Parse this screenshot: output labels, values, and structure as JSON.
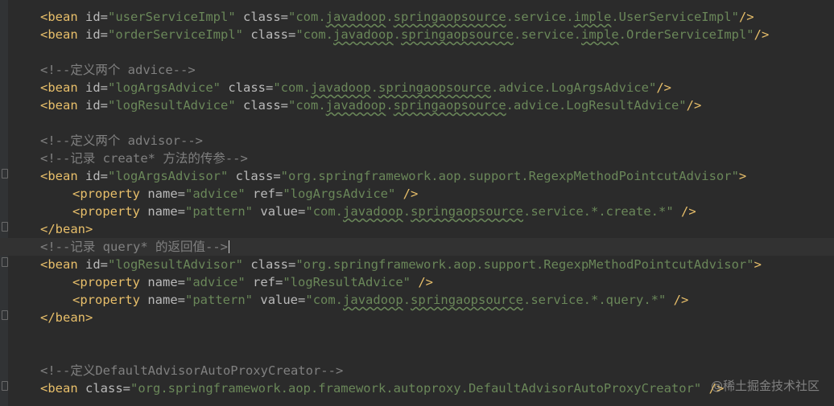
{
  "lines": [
    {
      "open": "<bean",
      "id": "\"userServiceImpl\"",
      "cls_pre": "\"com.",
      "cls_w1": "javadoop",
      "cls_mid": ".",
      "cls_w2": "springaopsource",
      "cls_mid2": ".service.",
      "cls_w3": "imple",
      "cls_post": ".UserServiceImpl\"",
      "close": "/>"
    },
    {
      "open": "<bean",
      "id": "\"orderServiceImpl\"",
      "cls_pre": "\"com.",
      "cls_w1": "javadoop",
      "cls_mid": ".",
      "cls_w2": "springaopsource",
      "cls_mid2": ".service.",
      "cls_w3": "imple",
      "cls_post": ".OrderServiceImpl\"",
      "close": "/>"
    }
  ],
  "comment_advice": "<!--定义两个 advice-->",
  "advice_beans": [
    {
      "open": "<bean",
      "id": "\"logArgsAdvice\"",
      "cls_pre": "\"com.",
      "cls_w1": "javadoop",
      "cls_mid": ".",
      "cls_w2": "springaopsource",
      "cls_post": ".advice.LogArgsAdvice\"",
      "close": "/>"
    },
    {
      "open": "<bean",
      "id": "\"logResultAdvice\"",
      "cls_pre": "\"com.",
      "cls_w1": "javadoop",
      "cls_mid": ".",
      "cls_w2": "springaopsource",
      "cls_post": ".advice.LogResultAdvice\"",
      "close": "/>"
    }
  ],
  "comment_advisor": "<!--定义两个 advisor-->",
  "comment_create": "<!--记录 create* 方法的传参-->",
  "advisor1": {
    "open": "<bean",
    "id": "\"logArgsAdvisor\"",
    "cls": "\"org.springframework.aop.support.RegexpMethodPointcutAdvisor\"",
    "close": ">",
    "prop_tag": "<property",
    "p1_name": "\"advice\"",
    "p1_ref": "\"logArgsAdvice\"",
    "p2_name": "\"pattern\"",
    "p2_pre": "\"com.",
    "p2_w1": "javadoop",
    "p2_mid": ".",
    "p2_w2": "springaopsource",
    "p2_post": ".service.*.create.*\"",
    "end": "</bean>"
  },
  "comment_query": "<!--记录 query* 的返回值-->",
  "advisor2": {
    "open": "<bean",
    "id": "\"logResultAdvisor\"",
    "cls": "\"org.springframework.aop.support.RegexpMethodPointcutAdvisor\"",
    "close": ">",
    "prop_tag": "<property",
    "p1_name": "\"advice\"",
    "p1_ref": "\"logResultAdvice\"",
    "p2_name": "\"pattern\"",
    "p2_pre": "\"com.",
    "p2_w1": "javadoop",
    "p2_mid": ".",
    "p2_w2": "springaopsource",
    "p2_post": ".service.*.query.*\"",
    "end": "</bean>"
  },
  "comment_creator": "<!--定义DefaultAdvisorAutoProxyCreator-->",
  "creator": {
    "open": "<bean",
    "cls": "\"org.springframework.aop.framework.autoproxy.DefaultAdvisorAutoProxyCreator\"",
    "close": "/>"
  },
  "kw": {
    "id": "id=",
    "class": "class=",
    "name": "name=",
    "ref": "ref=",
    "value": "value=",
    "selfclose": "/>"
  },
  "watermark": "@稀土掘金技术社区",
  "colors": {
    "background": "#2b2b2b",
    "tag": "#e8bf6a",
    "attribute": "#bababa",
    "string": "#6a8759",
    "comment": "#808080"
  }
}
